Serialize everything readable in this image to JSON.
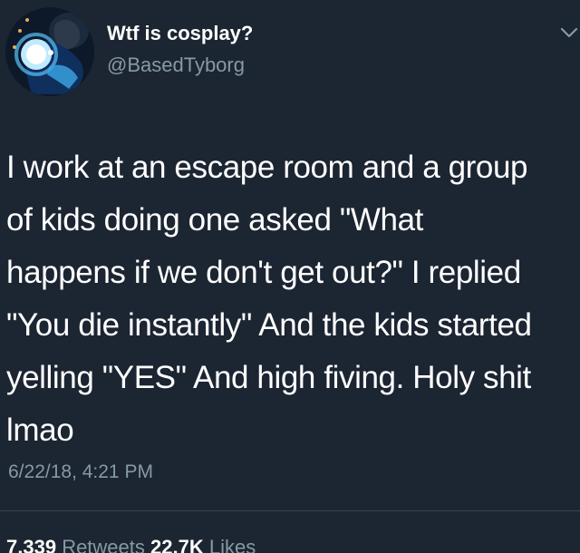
{
  "author": {
    "name": "Wtf is cosplay?",
    "handle": "@BasedTyborg"
  },
  "tweet": {
    "lines": [
      "I work at an escape room and a group",
      "of kids doing one asked \"What",
      "happens if we don't get out?\" I replied",
      "\"You die instantly\" And the kids started",
      "yelling \"YES\" And high fiving. Holy shit",
      "lmao"
    ],
    "timestamp": "6/22/18, 4:21 PM"
  },
  "stats": {
    "retweets_count": "7,339",
    "retweets_label": "Retweets",
    "likes_count": "22.7K",
    "likes_label": "Likes"
  },
  "icons": {
    "menu": "chevron-down-icon",
    "avatar": "profile-avatar"
  },
  "colors": {
    "background": "#1c2532",
    "primary_text": "#ffffff",
    "secondary_text": "#8899a6",
    "divider": "#38444d"
  }
}
